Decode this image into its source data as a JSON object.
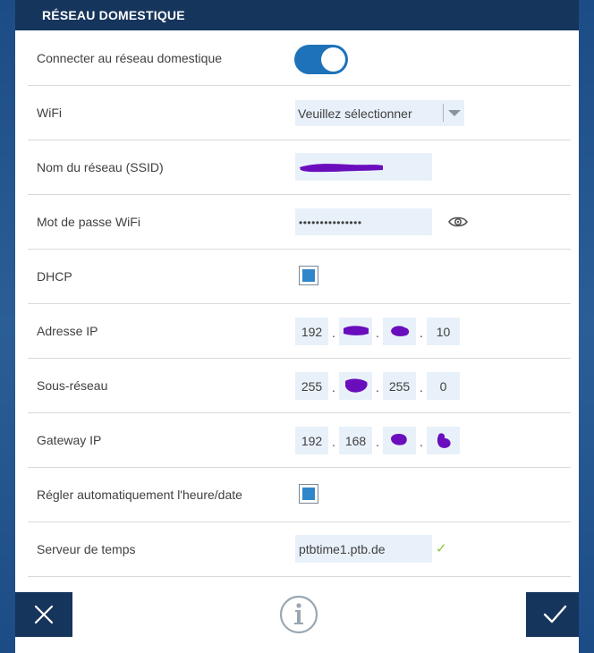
{
  "header": {
    "title": "RÉSEAU DOMESTIQUE"
  },
  "rows": {
    "connect": {
      "label": "Connecter au réseau domestique",
      "toggle_on": true
    },
    "wifi": {
      "label": "WiFi",
      "value": "Veuillez sélectionner"
    },
    "ssid": {
      "label": "Nom du réseau (SSID)"
    },
    "password": {
      "label": "Mot de passe WiFi",
      "value": "•••••••••••••••"
    },
    "dhcp": {
      "label": "DHCP",
      "checked": true
    },
    "ip": {
      "label": "Adresse IP",
      "parts": [
        "192",
        "",
        "",
        "10"
      ]
    },
    "subnet": {
      "label": "Sous-réseau",
      "parts": [
        "255",
        "",
        "255",
        "0"
      ]
    },
    "gateway": {
      "label": "Gateway IP",
      "parts": [
        "192",
        "168",
        "",
        ""
      ]
    },
    "auto_time": {
      "label": "Régler automatiquement l'heure/date",
      "checked": true
    },
    "time_server": {
      "label": "Serveur de temps",
      "value": "ptbtime1.ptb.de"
    }
  },
  "ip_separator": ".",
  "colors": {
    "header_bg": "#16355c",
    "toggle_on": "#1e72b8",
    "field_bg": "#e8f1f9",
    "checkbox_fill": "#2f86c8",
    "redaction": "#6a0dbd",
    "valid_check": "#8cc63f"
  },
  "icons": {
    "cancel": "close-icon",
    "info": "info-icon",
    "confirm": "checkmark-icon",
    "password_reveal": "eye-icon"
  }
}
